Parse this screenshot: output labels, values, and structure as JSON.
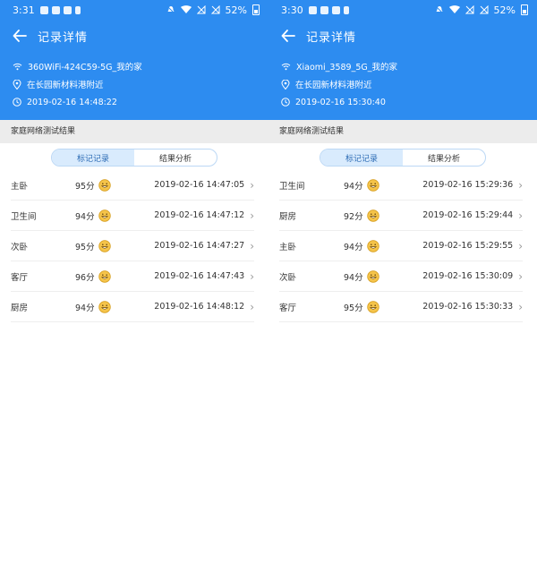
{
  "phones": [
    {
      "status": {
        "time": "3:31",
        "battery": "52%"
      },
      "title": "记录详情",
      "wifi_name": "360WiFi-424C59-5G_我的家",
      "location": "在长园新材料港附近",
      "timestamp": "2019-02-16 14:48:22",
      "section_title": "家庭网络测试结果",
      "tabs": [
        "标记记录",
        "结果分析"
      ],
      "rows": [
        {
          "room": "主卧",
          "score": "95分",
          "time": "2019-02-16 14:47:05"
        },
        {
          "room": "卫生间",
          "score": "94分",
          "time": "2019-02-16 14:47:12"
        },
        {
          "room": "次卧",
          "score": "95分",
          "time": "2019-02-16 14:47:27"
        },
        {
          "room": "客厅",
          "score": "96分",
          "time": "2019-02-16 14:47:43"
        },
        {
          "room": "厨房",
          "score": "94分",
          "time": "2019-02-16 14:48:12"
        }
      ]
    },
    {
      "status": {
        "time": "3:30",
        "battery": "52%"
      },
      "title": "记录详情",
      "wifi_name": "Xiaomi_3589_5G_我的家",
      "location": "在长园新材料港附近",
      "timestamp": "2019-02-16 15:30:40",
      "section_title": "家庭网络测试结果",
      "tabs": [
        "标记记录",
        "结果分析"
      ],
      "rows": [
        {
          "room": "卫生间",
          "score": "94分",
          "time": "2019-02-16 15:29:36"
        },
        {
          "room": "厨房",
          "score": "92分",
          "time": "2019-02-16 15:29:44"
        },
        {
          "room": "主卧",
          "score": "94分",
          "time": "2019-02-16 15:29:55"
        },
        {
          "room": "次卧",
          "score": "94分",
          "time": "2019-02-16 15:30:09"
        },
        {
          "room": "客厅",
          "score": "95分",
          "time": "2019-02-16 15:30:33"
        }
      ]
    }
  ],
  "colors": {
    "primary": "#2d8cf0",
    "section_bg": "#ececec",
    "face": "#f5c44a"
  }
}
